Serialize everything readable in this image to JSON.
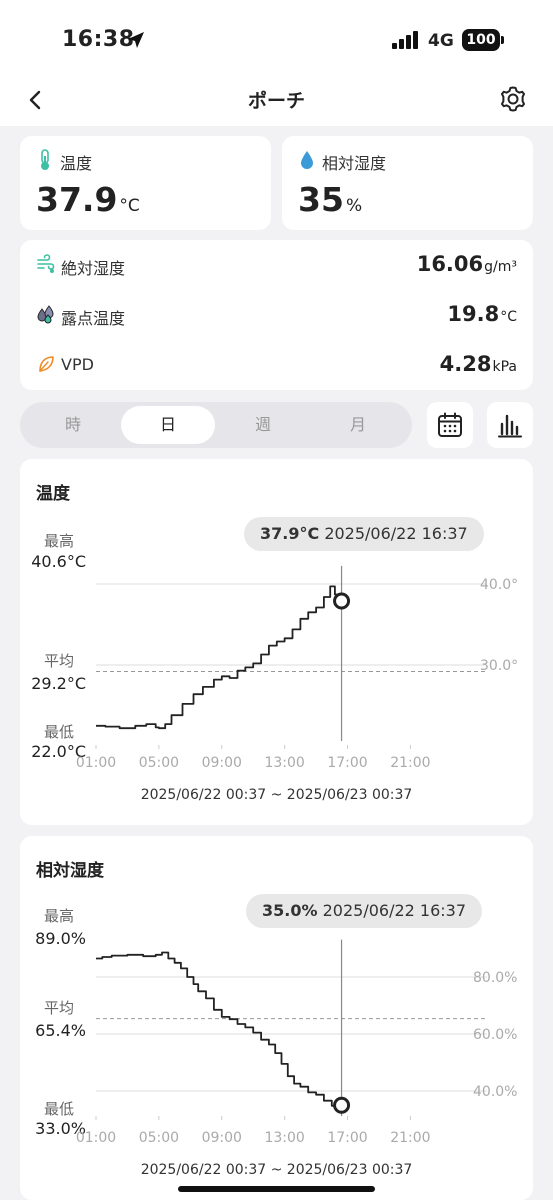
{
  "status": {
    "time": "16:38",
    "network": "4G",
    "battery": "100"
  },
  "nav": {
    "title": "ポーチ"
  },
  "temperature": {
    "label": "温度",
    "value": "37.9",
    "unit": "°C"
  },
  "humidity": {
    "label": "相対湿度",
    "value": "35",
    "unit": "%"
  },
  "details": [
    {
      "icon": "wind-humidity-icon",
      "label": "絶対湿度",
      "value": "16.06",
      "unit": "g/m³"
    },
    {
      "icon": "dew-drops-icon",
      "label": "露点温度",
      "value": "19.8",
      "unit": "°C"
    },
    {
      "icon": "leaf-icon",
      "label": "VPD",
      "value": "4.28",
      "unit": "kPa"
    }
  ],
  "period_tabs": [
    {
      "label": "時",
      "active": false
    },
    {
      "label": "日",
      "active": true
    },
    {
      "label": "週",
      "active": false
    },
    {
      "label": "月",
      "active": false
    }
  ],
  "colors": {
    "accent_temp": "#3dbfa3",
    "accent_hum": "#3a9bd8",
    "accent_leaf": "#f08a24",
    "line": "#222222",
    "grid": "#dddddd",
    "axis_text": "#aaaaaa"
  },
  "charts": [
    {
      "title": "温度",
      "max_label": "最高",
      "max_value": "40.6°C",
      "avg_label": "平均",
      "avg_value": "29.2°C",
      "min_label": "最低",
      "min_value": "22.0°C",
      "tooltip_value": "37.9°C",
      "tooltip_time": "2025/06/22 16:37",
      "range": "2025/06/22 00:37 ~ 2025/06/23 00:37"
    },
    {
      "title": "相対湿度",
      "max_label": "最高",
      "max_value": "89.0%",
      "avg_label": "平均",
      "avg_value": "65.4%",
      "min_label": "最低",
      "min_value": "33.0%",
      "tooltip_value": "35.0%",
      "tooltip_time": "2025/06/22 16:37",
      "range": "2025/06/22 00:37 ~ 2025/06/23 00:37"
    }
  ],
  "chart_data": [
    {
      "type": "line",
      "title": "温度",
      "x_ticks": [
        "01:00",
        "05:00",
        "09:00",
        "13:00",
        "17:00",
        "21:00"
      ],
      "y_ticks": [
        "30.0°",
        "40.0°"
      ],
      "x_domain": [
        1,
        24.6
      ],
      "ylim": [
        21.5,
        41.5
      ],
      "avg_line": 29.2,
      "cursor_x": 16.62,
      "cursor_y": 37.9,
      "series": [
        {
          "x": [
            1.0,
            1.6,
            2.5,
            3.5,
            4.2,
            4.8,
            5.0,
            5.4,
            5.8,
            6.5,
            7.2,
            7.8,
            8.5,
            9.0,
            9.5,
            10.0,
            10.5,
            11.0,
            11.5,
            12.0,
            12.5,
            13.0,
            13.5,
            14.0,
            14.5,
            15.0,
            15.5,
            15.9,
            16.2,
            16.62
          ],
          "y": [
            22.5,
            22.4,
            22.2,
            22.5,
            22.7,
            22.3,
            22.2,
            22.7,
            23.8,
            25.2,
            26.4,
            27.3,
            28.2,
            28.6,
            28.4,
            29.3,
            29.7,
            30.2,
            31.3,
            32.4,
            32.9,
            33.3,
            34.4,
            35.7,
            36.5,
            37.1,
            38.4,
            39.7,
            38.7,
            37.9
          ]
        }
      ]
    },
    {
      "type": "line",
      "title": "相対湿度",
      "x_ticks": [
        "01:00",
        "05:00",
        "09:00",
        "13:00",
        "17:00",
        "21:00"
      ],
      "y_ticks": [
        "40.0%",
        "60.0%",
        "80.0%"
      ],
      "x_domain": [
        1,
        24.6
      ],
      "ylim": [
        31.5,
        91.0
      ],
      "avg_line": 65.4,
      "cursor_x": 16.62,
      "cursor_y": 35.0,
      "series": [
        {
          "x": [
            1.0,
            1.4,
            2.0,
            3.0,
            4.0,
            4.8,
            5.2,
            5.6,
            6.0,
            6.4,
            6.8,
            7.2,
            7.5,
            8.0,
            8.5,
            9.0,
            9.5,
            10.0,
            10.5,
            11.0,
            11.5,
            12.0,
            12.4,
            12.8,
            13.2,
            13.6,
            14.0,
            14.5,
            15.0,
            15.5,
            16.0,
            16.62
          ],
          "y": [
            86.5,
            87.0,
            87.5,
            87.8,
            87.3,
            87.8,
            88.6,
            86.5,
            85.0,
            83.0,
            80.0,
            77.5,
            75.0,
            72.5,
            68.5,
            66.0,
            65.2,
            63.5,
            62.3,
            60.5,
            58.0,
            56.3,
            53.3,
            49.5,
            45.2,
            42.6,
            41.5,
            39.5,
            38.7,
            36.6,
            34.8,
            35.0
          ]
        }
      ]
    }
  ]
}
